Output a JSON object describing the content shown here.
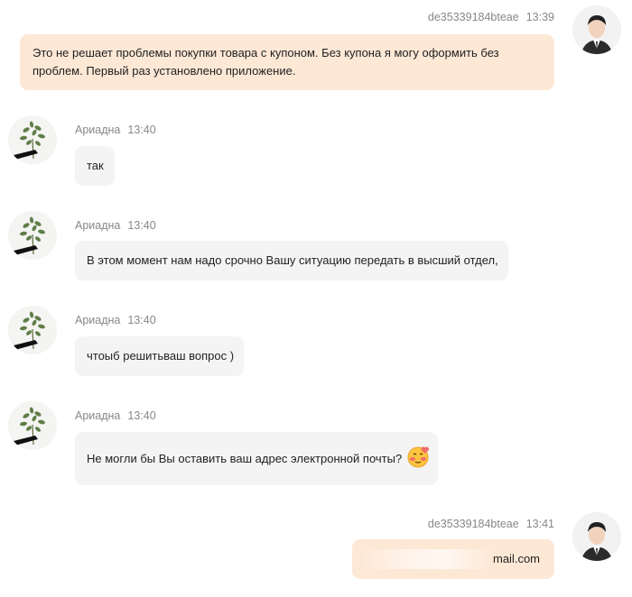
{
  "messages": [
    {
      "id": "m1",
      "direction": "out",
      "sender": "de35339184bteae",
      "time": "13:39",
      "text": "Это не решает проблемы покупки товара с купоном. Без купона я могу оформить без проблем. Первый раз установлено приложение."
    },
    {
      "id": "m2",
      "direction": "in",
      "sender": "Ариадна",
      "time": "13:40",
      "text": "так"
    },
    {
      "id": "m3",
      "direction": "in",
      "sender": "Ариадна",
      "time": "13:40",
      "text": "В этом момент нам надо срочно Вашу ситуацию передать в высший отдел,"
    },
    {
      "id": "m4",
      "direction": "in",
      "sender": "Ариадна",
      "time": "13:40",
      "text": "чтоыб решитьваш вопрос )"
    },
    {
      "id": "m5",
      "direction": "in",
      "sender": "Ариадна",
      "time": "13:40",
      "text": "Не могли бы Вы оставить ваш адрес электронной почты?",
      "emoji": "blushing-face-emoji"
    },
    {
      "id": "m6",
      "direction": "out",
      "sender": "de35339184bteae",
      "time": "13:41",
      "text_visible": "mail.com",
      "redacted": true
    }
  ],
  "colors": {
    "outgoing_bubble": "#fde8d6",
    "incoming_bubble": "#f4f4f4",
    "meta_text": "#888888"
  }
}
